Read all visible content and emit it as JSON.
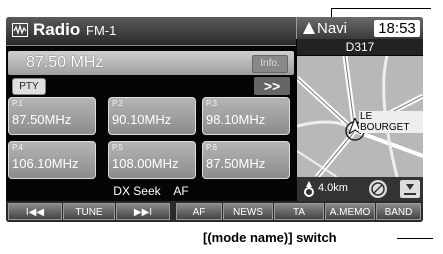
{
  "header": {
    "title": "Radio",
    "band": "FM-1",
    "navi_label": "Navi",
    "clock": "18:53",
    "road_name": "D317"
  },
  "tuner": {
    "frequency": "87.50 MHz",
    "info_label": "Info.",
    "pty_label": "PTY",
    "seek_label": ">>"
  },
  "presets": [
    {
      "num": "P.1",
      "freq": "87.50MHz"
    },
    {
      "num": "P.2",
      "freq": "90.10MHz"
    },
    {
      "num": "P.3",
      "freq": "98.10MHz"
    },
    {
      "num": "P.4",
      "freq": "106.10MHz"
    },
    {
      "num": "P.5",
      "freq": "108.00MHz"
    },
    {
      "num": "P.6",
      "freq": "87.50MHz"
    }
  ],
  "status": {
    "seek_mode": "DX Seek",
    "af": "AF"
  },
  "map": {
    "place": "LE BOURGET",
    "distance": "4.0km"
  },
  "buttons": {
    "prev": "I◀◀",
    "tune": "TUNE",
    "next": "▶▶I",
    "af": "AF",
    "news": "NEWS",
    "ta": "TA",
    "amemo": "A.MEMO",
    "band": "BAND"
  },
  "callout": "[(mode name)] switch",
  "colors": {
    "screen_bg": "#050505",
    "preset_bg": "#9e9e9e",
    "accent_white": "#ffffff"
  }
}
